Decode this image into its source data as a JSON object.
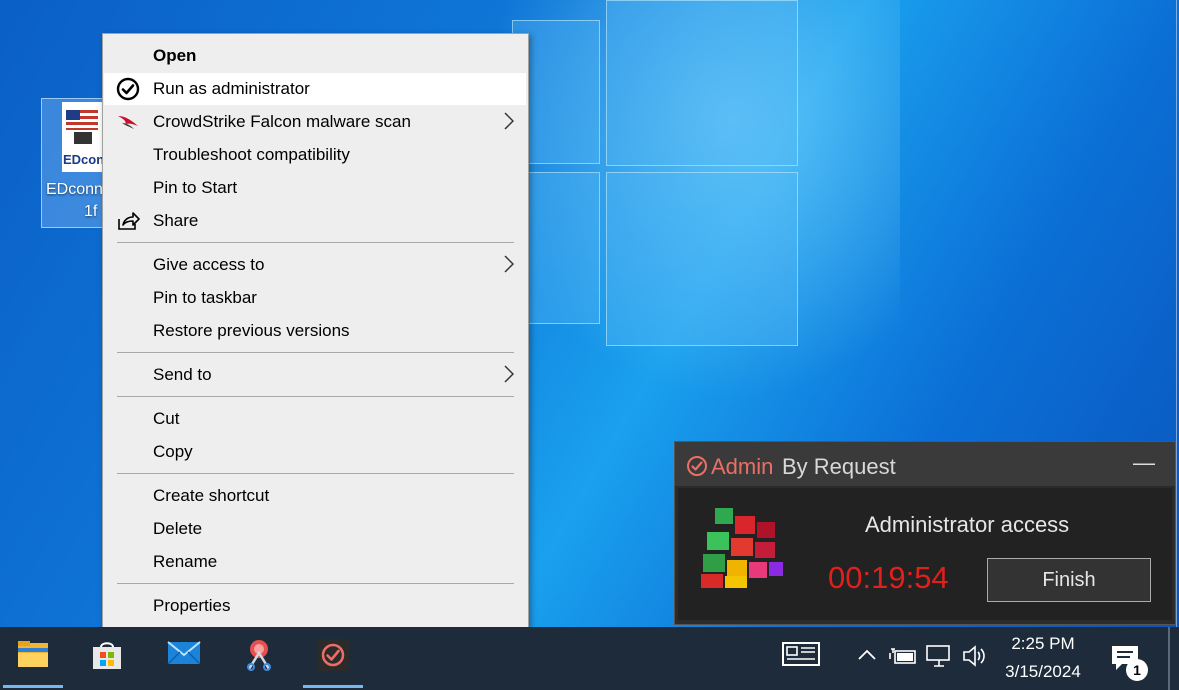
{
  "desktop": {
    "icon": {
      "thumb_text": "EDcon",
      "label_line1": "EDconn",
      "label_line2": "1f"
    }
  },
  "context_menu": {
    "items": [
      {
        "label": "Open",
        "bold": true
      },
      {
        "label": "Run as administrator",
        "icon": "run-as-admin-check-icon",
        "highlighted": true
      },
      {
        "label": "CrowdStrike Falcon malware scan",
        "icon": "crowdstrike-falcon-icon",
        "submenu": true
      },
      {
        "label": "Troubleshoot compatibility"
      },
      {
        "label": "Pin to Start"
      },
      {
        "label": "Share",
        "icon": "share-icon"
      },
      {
        "label": "Give access to",
        "submenu": true
      },
      {
        "label": "Pin to taskbar"
      },
      {
        "label": "Restore previous versions"
      },
      {
        "label": "Send to",
        "submenu": true
      },
      {
        "label": "Cut"
      },
      {
        "label": "Copy"
      },
      {
        "label": "Create shortcut"
      },
      {
        "label": "Delete"
      },
      {
        "label": "Rename"
      },
      {
        "label": "Properties"
      }
    ]
  },
  "admin_by_request": {
    "brand_part1": "Admin",
    "brand_part2": "By Request",
    "minimize_label": "—",
    "title": "Administrator access",
    "timer": "00:19:54",
    "finish_label": "Finish",
    "colors": {
      "brand_red": "#ec6f66",
      "timer_red": "#e0201a",
      "background": "#2b2b2b"
    }
  },
  "taskbar": {
    "apps": [
      {
        "name": "file-explorer-icon",
        "active": true
      },
      {
        "name": "microsoft-store-icon",
        "active": false
      },
      {
        "name": "mail-icon",
        "active": false
      },
      {
        "name": "snipping-tool-icon",
        "active": false
      },
      {
        "name": "admin-by-request-icon",
        "active": true
      }
    ],
    "tray": [
      "news-widget-icon",
      "show-hidden-icons-chevron",
      "power-icon",
      "network-icon",
      "volume-icon"
    ],
    "time": "2:25 PM",
    "date": "3/15/2024",
    "notification_count": "1"
  }
}
